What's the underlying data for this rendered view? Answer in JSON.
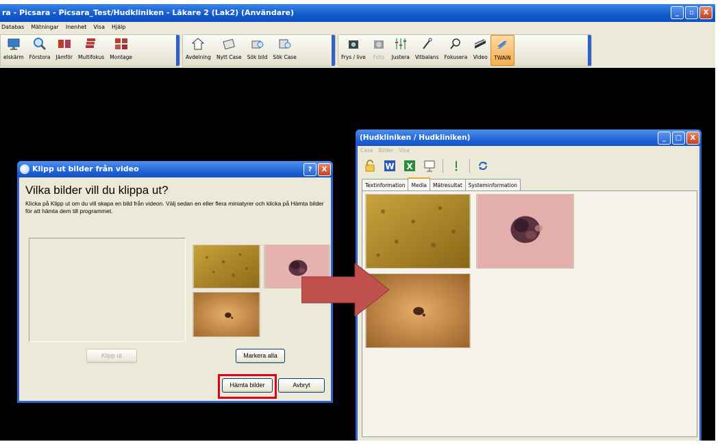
{
  "main_window": {
    "title": "ra - Picsara - Picsara_Test/Hudkliniken - Läkare 2  (Lak2) (Användare)",
    "window_buttons": [
      "_",
      "▫",
      "X"
    ]
  },
  "menu": [
    "Databas",
    "Mätningar",
    "Inenhet",
    "Visa",
    "Hjälp"
  ],
  "toolbar": {
    "group1": [
      {
        "label": "elskärm",
        "icon": "monitor-icon"
      },
      {
        "label": "Förstora",
        "icon": "magnifier-icon"
      },
      {
        "label": "Jämför",
        "icon": "compare-icon"
      },
      {
        "label": "Multifokus",
        "icon": "multifocus-icon"
      },
      {
        "label": "Montage",
        "icon": "montage-icon"
      }
    ],
    "group2": [
      {
        "label": "Avdelning",
        "icon": "department-icon"
      },
      {
        "label": "Nytt Case",
        "icon": "new-case-icon"
      },
      {
        "label": "Sök bild",
        "icon": "search-image-icon"
      },
      {
        "label": "Sök Case",
        "icon": "search-case-icon"
      }
    ],
    "group3": [
      {
        "label": "Frys / live",
        "icon": "freeze-camera-icon"
      },
      {
        "label": "Foto",
        "icon": "photo-camera-icon"
      },
      {
        "label": "Justera",
        "icon": "adjust-sliders-icon"
      },
      {
        "label": "Vitbalans",
        "icon": "white-balance-icon"
      },
      {
        "label": "Fokusera",
        "icon": "focus-icon"
      },
      {
        "label": "Video",
        "icon": "video-icon"
      },
      {
        "label": "TWAIN",
        "icon": "twain-icon"
      }
    ]
  },
  "dialog": {
    "title": "Klipp ut bilder från video",
    "heading": "Vilka bilder vill du klippa ut?",
    "instructions": "Klicka på Klipp ut om du vill skapa en bild från videon. Välj sedan en eller flera miniatyrer och klicka på Hämta bilder för att hämta dem till programmet.",
    "buttons": {
      "cut": "Klipp ut",
      "select_all": "Markera alla",
      "fetch": "Hämta bilder",
      "cancel": "Avbryt"
    },
    "title_buttons": [
      "?",
      "X"
    ]
  },
  "case_window": {
    "title": "(Hudkliniken / Hudkliniken)",
    "menu": [
      "Case",
      "Bilder",
      "Visa"
    ],
    "tabs": [
      "Textinformation",
      "Media",
      "Mätresultat",
      "Systeminformation"
    ],
    "selected_tab": "Media",
    "window_buttons": [
      "_",
      "□",
      "X"
    ]
  },
  "colors": {
    "highlight": "#e0001a",
    "arrow": "#c0504d",
    "titlebar": "#1c5fd2"
  }
}
